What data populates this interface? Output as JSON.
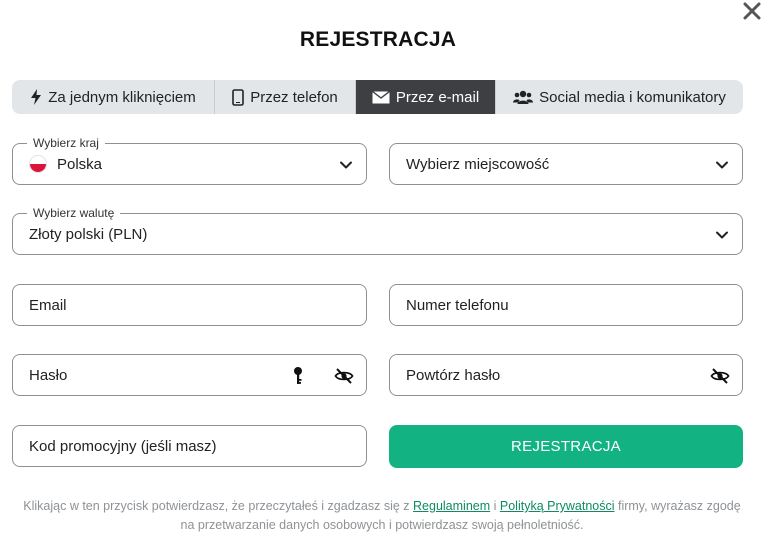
{
  "title": "REJESTRACJA",
  "tabs": [
    {
      "label": "Za jednym kliknięciem",
      "icon": "lightning-icon"
    },
    {
      "label": "Przez telefon",
      "icon": "phone-icon"
    },
    {
      "label": "Przez e-mail",
      "icon": "envelope-icon",
      "active": true
    },
    {
      "label": "Social media i komunikatory",
      "icon": "users-icon"
    }
  ],
  "country": {
    "legend": "Wybierz kraj",
    "value": "Polska"
  },
  "city": {
    "placeholder": "Wybierz miejscowość"
  },
  "currency": {
    "legend": "Wybierz walutę",
    "value": "Złoty polski (PLN)"
  },
  "email": {
    "placeholder": "Email"
  },
  "phone": {
    "placeholder": "Numer telefonu"
  },
  "password": {
    "placeholder": "Hasło"
  },
  "repeat_password": {
    "placeholder": "Powtórz hasło"
  },
  "promo": {
    "placeholder": "Kod promocyjny (jeśli masz)"
  },
  "submit_label": "REJESTRACJA",
  "terms": {
    "before": "Klikając w ten przycisk potwierdzasz, że przeczytałeś i zgadzasz się z ",
    "link1": "Regulaminem",
    "between": " i ",
    "link2": "Polityką Prywatności",
    "after": " firmy, wyrażasz zgodę na przetwarzanie danych osobowych i potwierdzasz swoją pełnoletniość."
  },
  "colors": {
    "accent": "#12b283",
    "active_tab": "#3d3f42",
    "tabs_bg": "#e3e6e9",
    "link": "#0f8a63"
  }
}
